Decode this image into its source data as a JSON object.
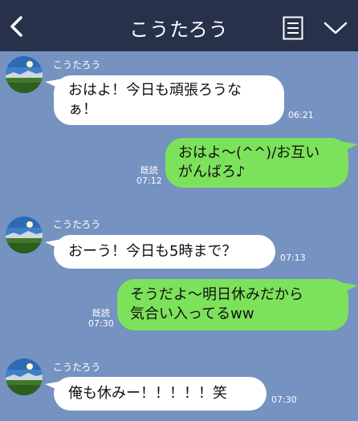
{
  "header": {
    "title": "こうたろう"
  },
  "contact": {
    "name": "こうたろう"
  },
  "messages": [
    {
      "dir": "in",
      "line1": "おはよ！今日も頑張ろうな",
      "line2": "ぁ！",
      "time": "06:21"
    },
    {
      "dir": "out",
      "line1": "おはよ〜(^^)/お互い",
      "line2": "がんばろ♪",
      "read": "既読",
      "time": "07:12"
    },
    {
      "dir": "in",
      "line1": "おーう！今日も5時まで？",
      "time": "07:13"
    },
    {
      "dir": "out",
      "line1": "そうだよ〜明日休みだから",
      "line2": "気合い入ってるww",
      "read": "既読",
      "time": "07:30"
    },
    {
      "dir": "in",
      "line1": "俺も休みー！！！！！笑",
      "time": "07:30"
    }
  ],
  "colors": {
    "header": "#27324a",
    "background": "#7592c1",
    "outgoing": "#7ce25b",
    "incoming": "#ffffff"
  },
  "icons": {
    "back": "chevron-left-icon",
    "menu": "list-menu-icon",
    "options": "chevron-down-icon"
  }
}
